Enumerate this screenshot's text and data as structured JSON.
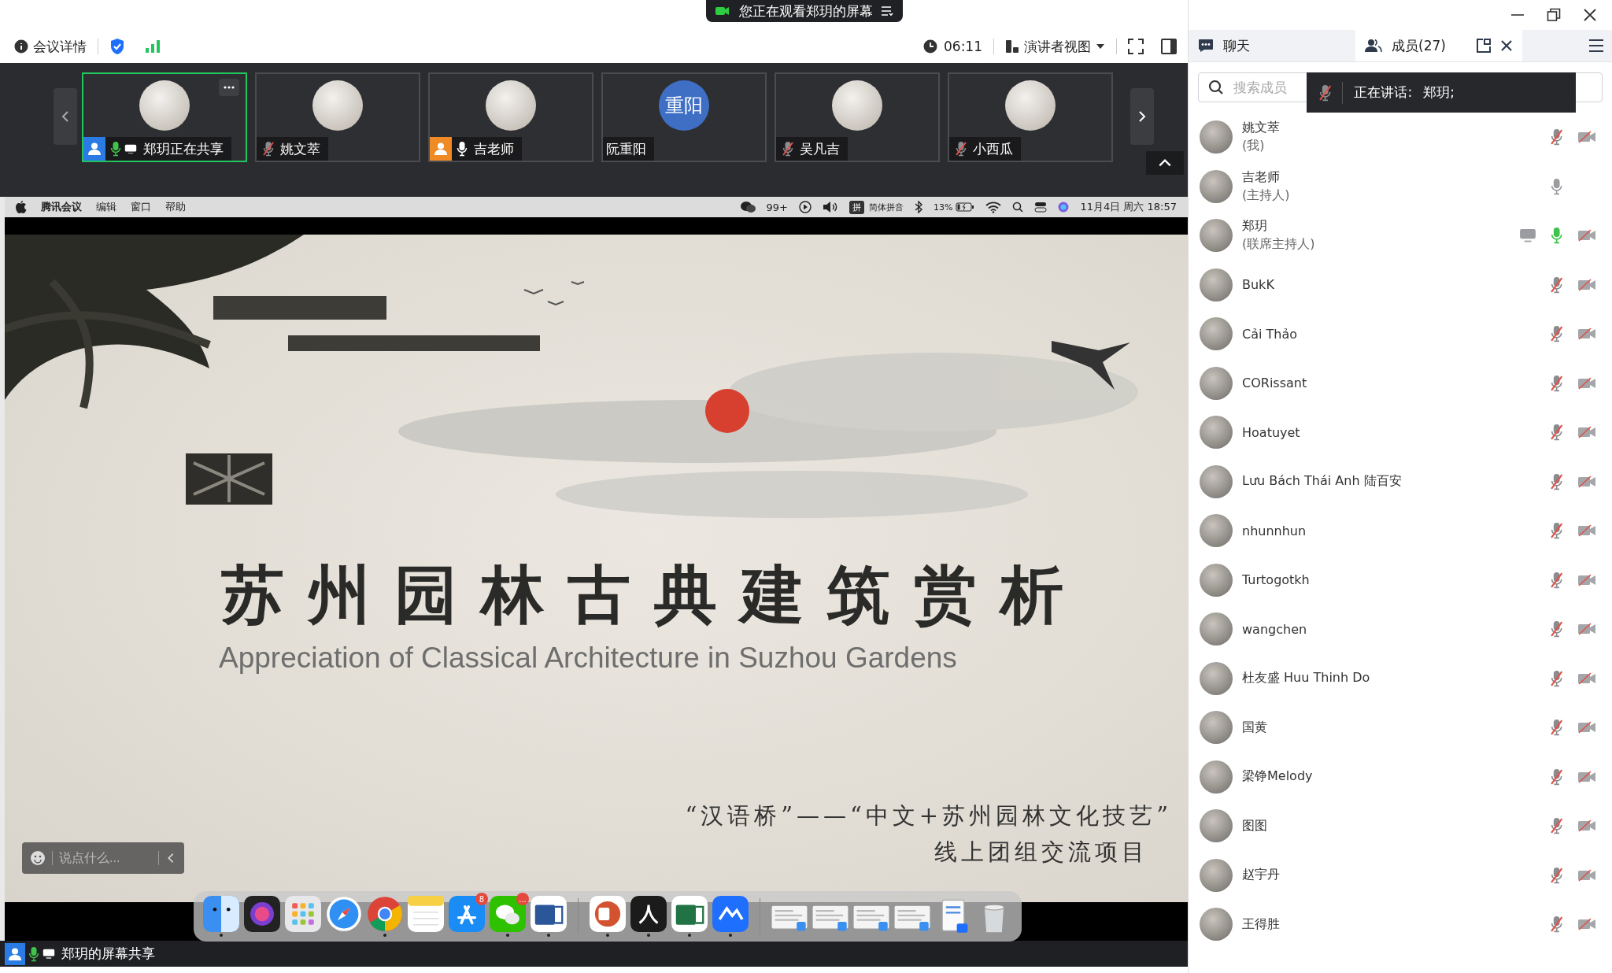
{
  "banner": {
    "text": "您正在观看郑玥的屏幕"
  },
  "toolbar": {
    "meeting_info": "会议详情",
    "timer": "06:11",
    "view_mode": "演讲者视图"
  },
  "video_strip": {
    "tiles": [
      {
        "name": "郑玥正在共享",
        "selected": true,
        "color": "#2a7be4",
        "muted": false,
        "speaking": true,
        "sharing": true
      },
      {
        "name": "姚文萃",
        "selected": false,
        "muted": true,
        "sharing": false
      },
      {
        "name": "吉老师",
        "selected": false,
        "color": "#f08a24",
        "muted": false,
        "speaking": false,
        "sharing": false
      },
      {
        "name": "阮重阳",
        "avatar_text": "重阳",
        "selected": false,
        "sharing": false
      },
      {
        "name": "吴凡吉",
        "selected": false,
        "muted": true,
        "sharing": false
      },
      {
        "name": "小西瓜",
        "selected": false,
        "muted": true,
        "sharing": false
      }
    ]
  },
  "mac_menubar": {
    "app": "腾讯会议",
    "menus": [
      "编辑",
      "窗口",
      "帮助"
    ],
    "wechat_count": "99+",
    "input_badge": "拼",
    "input_method": "简体拼音",
    "battery": "13%",
    "datetime": "11月4日 周六 18:57"
  },
  "slide": {
    "title": "苏州园林古典建筑赏析",
    "subtitle": "Appreciation of Classical Architecture in Suzhou Gardens",
    "footer_lines": [
      "“汉语桥”——“中文+苏州园林文化技艺”",
      "线上团组交流项目"
    ]
  },
  "chat_input": {
    "placeholder": "说点什么..."
  },
  "dock": {
    "apps": [
      {
        "kind": "finder",
        "running": true
      },
      {
        "kind": "siri",
        "running": false
      },
      {
        "kind": "launchpad",
        "running": false
      },
      {
        "kind": "safari",
        "running": false
      },
      {
        "kind": "chrome",
        "running": true
      },
      {
        "kind": "notes",
        "running": false
      },
      {
        "kind": "appstore",
        "running": false,
        "badge": "8"
      },
      {
        "kind": "wechat",
        "running": true,
        "badge": "..."
      },
      {
        "kind": "word",
        "running": true
      },
      {
        "kind": "separator"
      },
      {
        "kind": "powerpoint",
        "running": true
      },
      {
        "kind": "acrobat",
        "running": true
      },
      {
        "kind": "excel",
        "running": true
      },
      {
        "kind": "meeting",
        "running": true
      },
      {
        "kind": "separator"
      },
      {
        "kind": "thumbnail"
      },
      {
        "kind": "thumbnail"
      },
      {
        "kind": "thumbnail"
      },
      {
        "kind": "thumbnail"
      },
      {
        "kind": "document"
      },
      {
        "kind": "trash"
      }
    ]
  },
  "status_bar": {
    "text": "郑玥的屏幕共享"
  },
  "side_panel": {
    "tabs": [
      {
        "label": "聊天",
        "selected": false
      },
      {
        "label": "成员(27)",
        "selected": true
      }
    ],
    "search": {
      "placeholder": "搜索成员"
    },
    "speaking_toast": {
      "label": "正在讲话:",
      "names": "郑玥;"
    },
    "members": [
      {
        "name": "姚文萃",
        "role": "(我)",
        "muted": true,
        "camera_off": true,
        "sharing": false
      },
      {
        "name": "吉老师",
        "role": "(主持人)",
        "muted": false,
        "speaking": false,
        "camera_off": false,
        "sharing": false
      },
      {
        "name": "郑玥",
        "role": "(联席主持人)",
        "muted": false,
        "speaking": true,
        "camera_off": true,
        "sharing": true
      },
      {
        "name": "BukK",
        "muted": true,
        "camera_off": true,
        "sharing": false
      },
      {
        "name": "Cải Thảo",
        "muted": true,
        "camera_off": true,
        "sharing": false
      },
      {
        "name": "CORissant",
        "muted": true,
        "camera_off": true,
        "sharing": false
      },
      {
        "name": "Hoatuyet",
        "muted": true,
        "camera_off": true,
        "sharing": false
      },
      {
        "name": "Lưu Bách Thái Anh 陆百安",
        "muted": true,
        "camera_off": true,
        "sharing": false
      },
      {
        "name": "nhunnhun",
        "muted": true,
        "camera_off": true,
        "sharing": false
      },
      {
        "name": "Turtogotkh",
        "muted": true,
        "camera_off": true,
        "sharing": false
      },
      {
        "name": "wangchen",
        "muted": true,
        "camera_off": true,
        "sharing": false
      },
      {
        "name": "杜友盛 Huu Thinh Do",
        "muted": true,
        "camera_off": true,
        "sharing": false
      },
      {
        "name": "国黄",
        "muted": true,
        "camera_off": true,
        "sharing": false
      },
      {
        "name": "梁铮Melody",
        "muted": true,
        "camera_off": true,
        "sharing": false
      },
      {
        "name": "图图",
        "muted": true,
        "camera_off": true,
        "sharing": false
      },
      {
        "name": "赵宇丹",
        "muted": true,
        "camera_off": true,
        "sharing": false
      },
      {
        "name": "王得胜",
        "muted": true,
        "camera_off": true,
        "sharing": false
      }
    ]
  }
}
